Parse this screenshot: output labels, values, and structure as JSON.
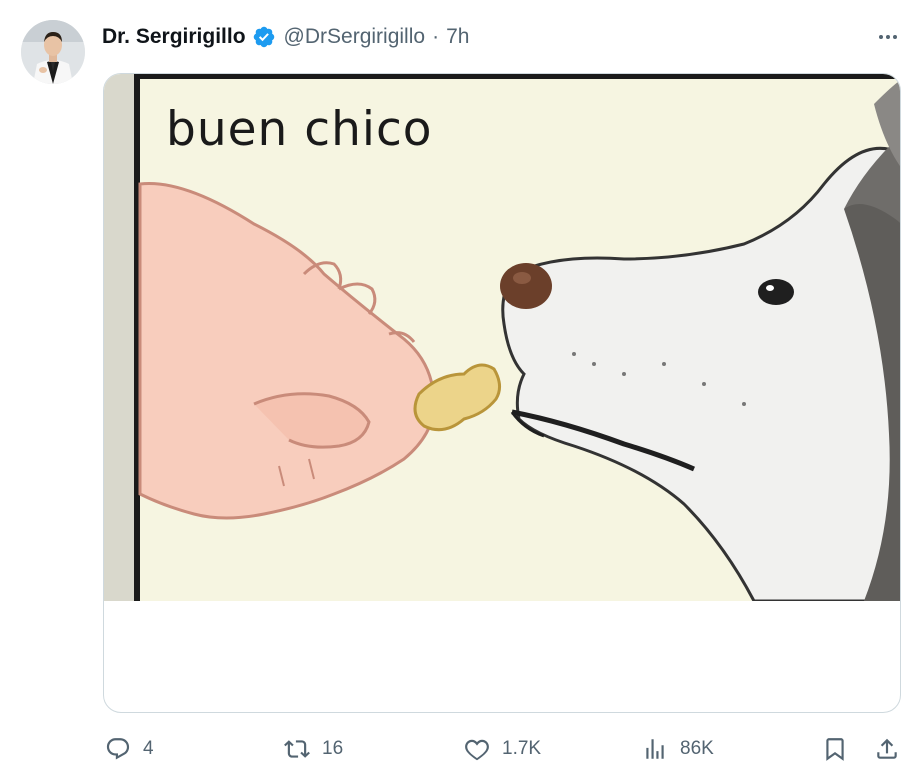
{
  "tweet": {
    "author": {
      "display_name": "Dr. Sergirigillo",
      "handle": "@DrSergirigillo",
      "verified": true
    },
    "separator": "·",
    "timestamp": "7h",
    "media": {
      "caption": "buen chico"
    },
    "actions": {
      "replies": "4",
      "retweets": "16",
      "likes": "1.7K",
      "views": "86K"
    }
  },
  "colors": {
    "verified_badge": "#1d9bf0",
    "secondary_text": "#536471",
    "card_border": "#cfd9de",
    "meme_background": "#f6f5e1"
  },
  "icons": {
    "more": "more-horizontal-icon",
    "reply": "reply-icon",
    "retweet": "retweet-icon",
    "like": "heart-icon",
    "views": "analytics-icon",
    "bookmark": "bookmark-icon",
    "share": "share-icon"
  }
}
